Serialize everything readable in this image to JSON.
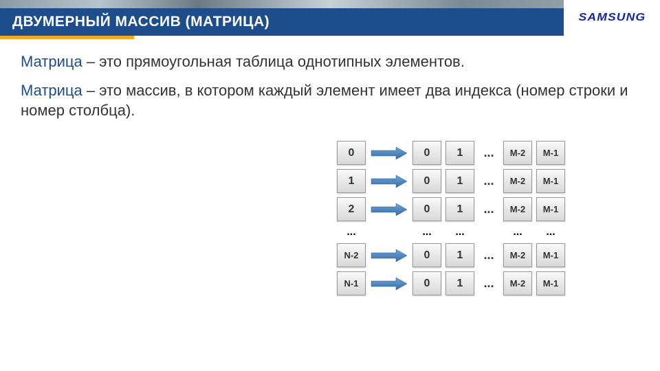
{
  "header": {
    "title": "ДВУМЕРНЫЙ МАССИВ  (МАТРИЦА)",
    "logo_text": "SAMSUNG"
  },
  "content": {
    "term": "Матрица",
    "para1_rest": " – это прямоугольная таблица однотипных элементов.",
    "para2_rest": " – это массив, в котором каждый элемент имеет два индекса (номер строки и номер столбца)."
  },
  "diagram": {
    "row_labels": [
      "0",
      "1",
      "2",
      "N-2",
      "N-1"
    ],
    "col_labels": [
      "0",
      "1",
      "M-2",
      "M-1"
    ],
    "ellipsis": "..."
  }
}
